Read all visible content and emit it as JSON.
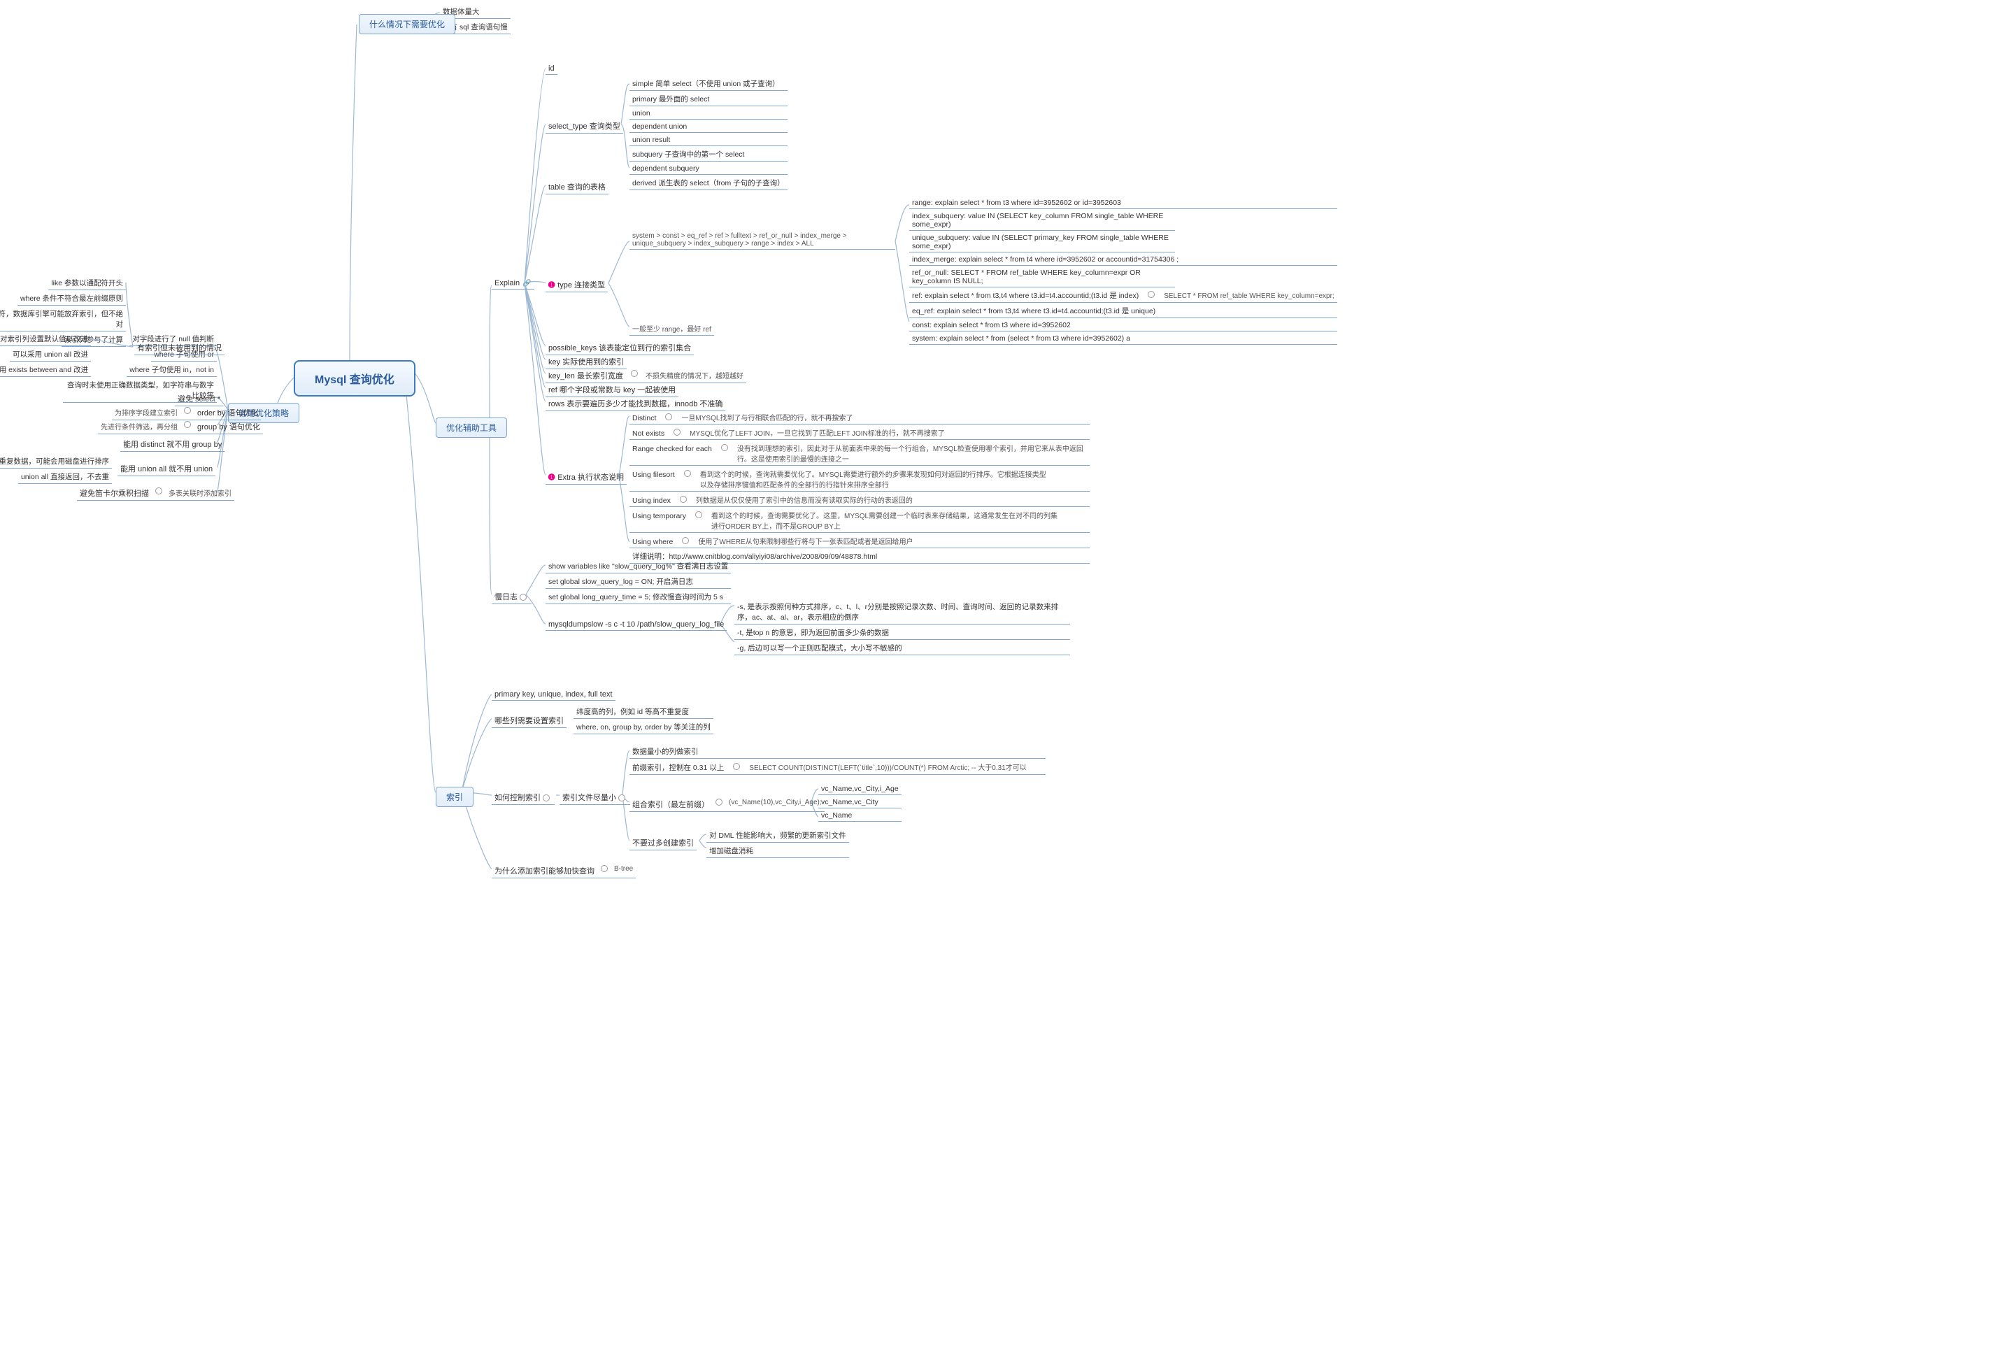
{
  "root": {
    "title": "Mysql 查询优化"
  },
  "when_optimize": {
    "label": "什么情况下需要优化",
    "children": [
      "数据体量大",
      "现有 sql 查询语句慢"
    ]
  },
  "tools": {
    "label": "优化辅助工具",
    "explain": {
      "label": "Explain",
      "children": {
        "id": "id",
        "select_type": {
          "label": "select_type 查询类型",
          "items": [
            "simple 简单 select（不使用 union 或子查询）",
            "primary 最外面的 select",
            "union",
            "dependent union",
            "union result",
            "subquery 子查询中的第一个 select",
            "dependent subquery",
            "derived 派生表的 select（from 子句的子查询）"
          ]
        },
        "table": "table 查询的表格",
        "type": {
          "label": "type 连接类型",
          "note1": "system > const > eq_ref > ref > fulltext > ref_or_null > index_merge > unique_subquery > index_subquery > range > index > ALL",
          "note2": "一般至少 range，最好 ref",
          "items": [
            "range: explain select * from t3 where id=3952602 or id=3952603",
            "index_subquery: value IN (SELECT key_column FROM single_table WHERE some_expr)",
            "unique_subquery: value IN (SELECT primary_key FROM single_table WHERE some_expr)",
            "index_merge: explain select * from t4 where id=3952602 or accountid=31754306 ;",
            "ref_or_null: SELECT * FROM ref_table WHERE key_column=expr OR key_column IS NULL;",
            "ref: explain select * from t3,t4 where t3.id=t4.accountid;(t3.id 是 index)",
            "eq_ref: explain select * from t3,t4 where t3.id=t4.accountid;(t3.id 是 unique)",
            "const: explain select * from t3 where id=3952602",
            "system: explain select * from (select * from t3 where id=3952602) a"
          ],
          "ref_side": "SELECT * FROM ref_table WHERE key_column=expr;"
        },
        "possible_keys": "possible_keys 该表能定位到行的索引集合",
        "key": "key 实际使用到的索引",
        "key_len": {
          "label": "key_len 最长索引宽度",
          "note": "不损失精度的情况下，越短越好"
        },
        "ref": "ref 哪个字段或常数与 key 一起被使用",
        "rows": "rows 表示要遍历多少才能找到数据，innodb 不准确",
        "extra": {
          "label": "Extra 执行状态说明",
          "items": [
            {
              "k": "Distinct",
              "v": "一旦MYSQL找到了与行相联合匹配的行，就不再搜索了"
            },
            {
              "k": "Not exists",
              "v": "MYSQL优化了LEFT JOIN，一旦它找到了匹配LEFT JOIN标准的行，就不再搜索了"
            },
            {
              "k": "Range checked for each",
              "v": "没有找到理想的索引，因此对于从前面表中来的每一个行组合，MYSQL检查使用哪个索引，并用它来从表中返回行。这是使用索引的最慢的连接之一"
            },
            {
              "k": "Using filesort",
              "v": "看到这个的时候，查询就需要优化了。MYSQL需要进行额外的步骤来发现如何对返回的行排序。它根据连接类型以及存储排序键值和匹配条件的全部行的行指针来排序全部行"
            },
            {
              "k": "Using index",
              "v": "列数据是从仅仅使用了索引中的信息而没有读取实际的行动的表返回的"
            },
            {
              "k": "Using temporary",
              "v": "看到这个的时候，查询需要优化了。这里，MYSQL需要创建一个临时表来存储结果，这通常发生在对不同的列集进行ORDER BY上，而不是GROUP BY上"
            },
            {
              "k": "Using where",
              "v": "使用了WHERE从句来限制哪些行将与下一张表匹配或者是返回给用户"
            }
          ],
          "detail_link": "详细说明：http://www.cnitblog.com/aliyiyi08/archive/2008/09/09/48878.html"
        }
      }
    },
    "slowlog": {
      "label": "慢日志",
      "items": [
        "show variables like \"slow_query_log%\" 查看满日志设置",
        "set global slow_query_log = ON; 开启满日志",
        "set global long_query_time = 5; 修改慢查询时间为 5 s"
      ],
      "dumpslow": {
        "label": "mysqldumpslow -s c -t 10 /path/slow_query_log_file",
        "items": [
          "-s, 是表示按照何种方式排序，c、t、l、r分别是按照记录次数、时间、查询时间、返回的记录数来排序，ac、at、al、ar，表示相应的倒序",
          "-t, 是top n 的意思，即为返回前面多少条的数据",
          "-g, 后边可以写一个正则匹配模式，大小写不敏感的"
        ]
      }
    }
  },
  "strategy": {
    "label": "常用优化策略",
    "index_unused": {
      "label": "有索引但未被用到的情况",
      "items": [
        "like 参数以通配符开头",
        "where 条件不符合最左前缀原则",
        "使用 != <> 操作符，数据库引擎可能放弃索引，但不绝对",
        "索引列参与了计算",
        "对字段进行了 null 值判断",
        "where 子句使用 or",
        "where 子句使用 in，not in",
        "查询时未使用正确数据类型，如字符串与数字比较等"
      ],
      "left_opts": [
        "对索引列设置默认值以改进",
        "可以采用 union all 改进",
        "使用 exists between and 改进"
      ]
    },
    "avoid_star": "避免 select *",
    "orderby": {
      "label": "order by 语句优化",
      "note": "为排序字段建立索引"
    },
    "groupby": {
      "label": "group by 语句优化",
      "note": "先进行条件筛选，再分组"
    },
    "distinct_union": {
      "label": "能用 distinct 就不用 group by",
      "label2": "能用 union all 就不用 union",
      "notes": [
        "union 会排序去掉重复数据，可能会用磁盘进行排序",
        "union all 直接返回，不去重"
      ]
    },
    "cartesian": {
      "label": "避免笛卡尔乘积扫描",
      "note": "多表关联时添加索引"
    }
  },
  "index": {
    "label": "索引",
    "types": "primary key, unique, index, full text",
    "which_cols": {
      "label": "哪些列需要设置索引",
      "items": [
        "纬度高的列，例如 id 等高不重复度",
        "where, on, group by, order by 等关注的列"
      ]
    },
    "control": {
      "label": "如何控制索引",
      "file_small": {
        "label": "索引文件尽量小",
        "items": [
          "数据量小的列做索引",
          "前缀索引，控制在 0.31 以上",
          "组合索引（最左前缀）",
          "不要过多创建索引"
        ],
        "prefix_note": "SELECT COUNT(DISTINCT(LEFT(`title`,10)))/COUNT(*) FROM Arctic; -- 大于0.31才可以",
        "combo_sample": "(vc_Name(10),vc_City,i_Age);",
        "combo_children": [
          "vc_Name,vc_City,i_Age",
          "vc_Name,vc_City",
          "vc_Name"
        ],
        "overcreate_notes": [
          "对 DML 性能影响大，频繁的更新索引文件",
          "增加磁盘消耗"
        ]
      }
    },
    "why_fast": {
      "label": "为什么添加索引能够加快查询",
      "note": "B-tree"
    }
  }
}
